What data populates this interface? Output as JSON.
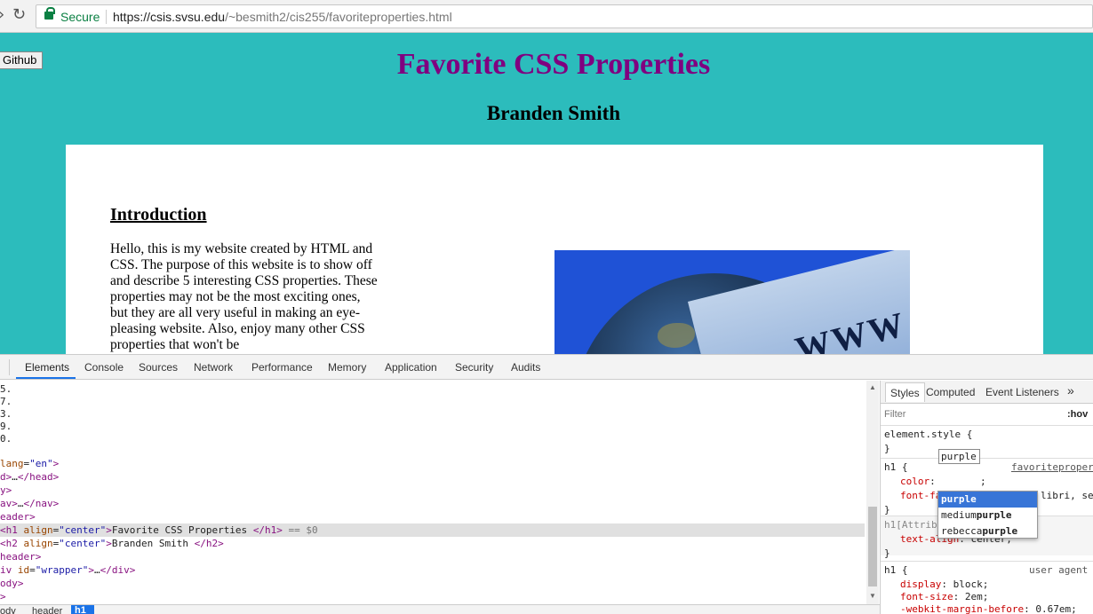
{
  "browser": {
    "secure_label": "Secure",
    "url_base": "https://csis.svsu.edu",
    "url_path": "/~besmith2/cis255/favoriteproperties.html",
    "reload_icon": "reload-icon",
    "lock_icon": "lock-icon"
  },
  "page": {
    "github_button": "Github",
    "title": "Favorite CSS Properties",
    "subtitle": "Branden Smith",
    "intro_heading": "Introduction",
    "intro_paragraph": "Hello, this is my website created by HTML and CSS. The purpose of this website is to show off and describe 5 interesting CSS properties. These properties may not be the most exciting ones, but they are all very useful in making an eye-pleasing website. Also, enjoy many other CSS properties that won't be",
    "image_text": "WWW",
    "colors": {
      "background": "#2cbcbc",
      "title": "#800080"
    }
  },
  "devtools": {
    "tabs": [
      "Elements",
      "Console",
      "Sources",
      "Network",
      "Performance",
      "Memory",
      "Application",
      "Security",
      "Audits"
    ],
    "active_tab": "Elements",
    "code_lines": [
      {
        "id": "l0",
        "text": "5."
      },
      {
        "id": "l1",
        "text": "7."
      },
      {
        "id": "l2",
        "text": "3."
      },
      {
        "id": "l3",
        "text": "9."
      },
      {
        "id": "l4",
        "text": "0."
      }
    ],
    "selected_suffix": " == $0",
    "breadcrumbs": [
      "ody",
      "header",
      "h1"
    ],
    "styles": {
      "tabs": [
        "Styles",
        "Computed",
        "Event Listeners"
      ],
      "more": "»",
      "filter_placeholder": "Filter",
      "hov": ":hov",
      "element_style_open": "element.style {",
      "close_brace": "}",
      "h1_selector": "h1 {",
      "h1_source": "favoriteproper",
      "color_prop": "color",
      "color_value": "purple",
      "font_family_prop": "font-fa",
      "font_family_value": "libri, se",
      "attr_selector": "h1[Attrib",
      "text_align_prop": "text-align",
      "text_align_value": "center;",
      "ua_selector": "h1 {",
      "ua_label": "user agent",
      "display_prop": "display",
      "display_value": "block;",
      "font_size_prop": "font-size",
      "font_size_value": "2em;",
      "margin_prop": "-webkit-margin-before",
      "margin_value": "0.67em;"
    },
    "autocomplete": [
      {
        "prefix": "",
        "match": "purple"
      },
      {
        "prefix": "medium",
        "match": "purple"
      },
      {
        "prefix": "rebecca",
        "match": "purple"
      }
    ]
  }
}
